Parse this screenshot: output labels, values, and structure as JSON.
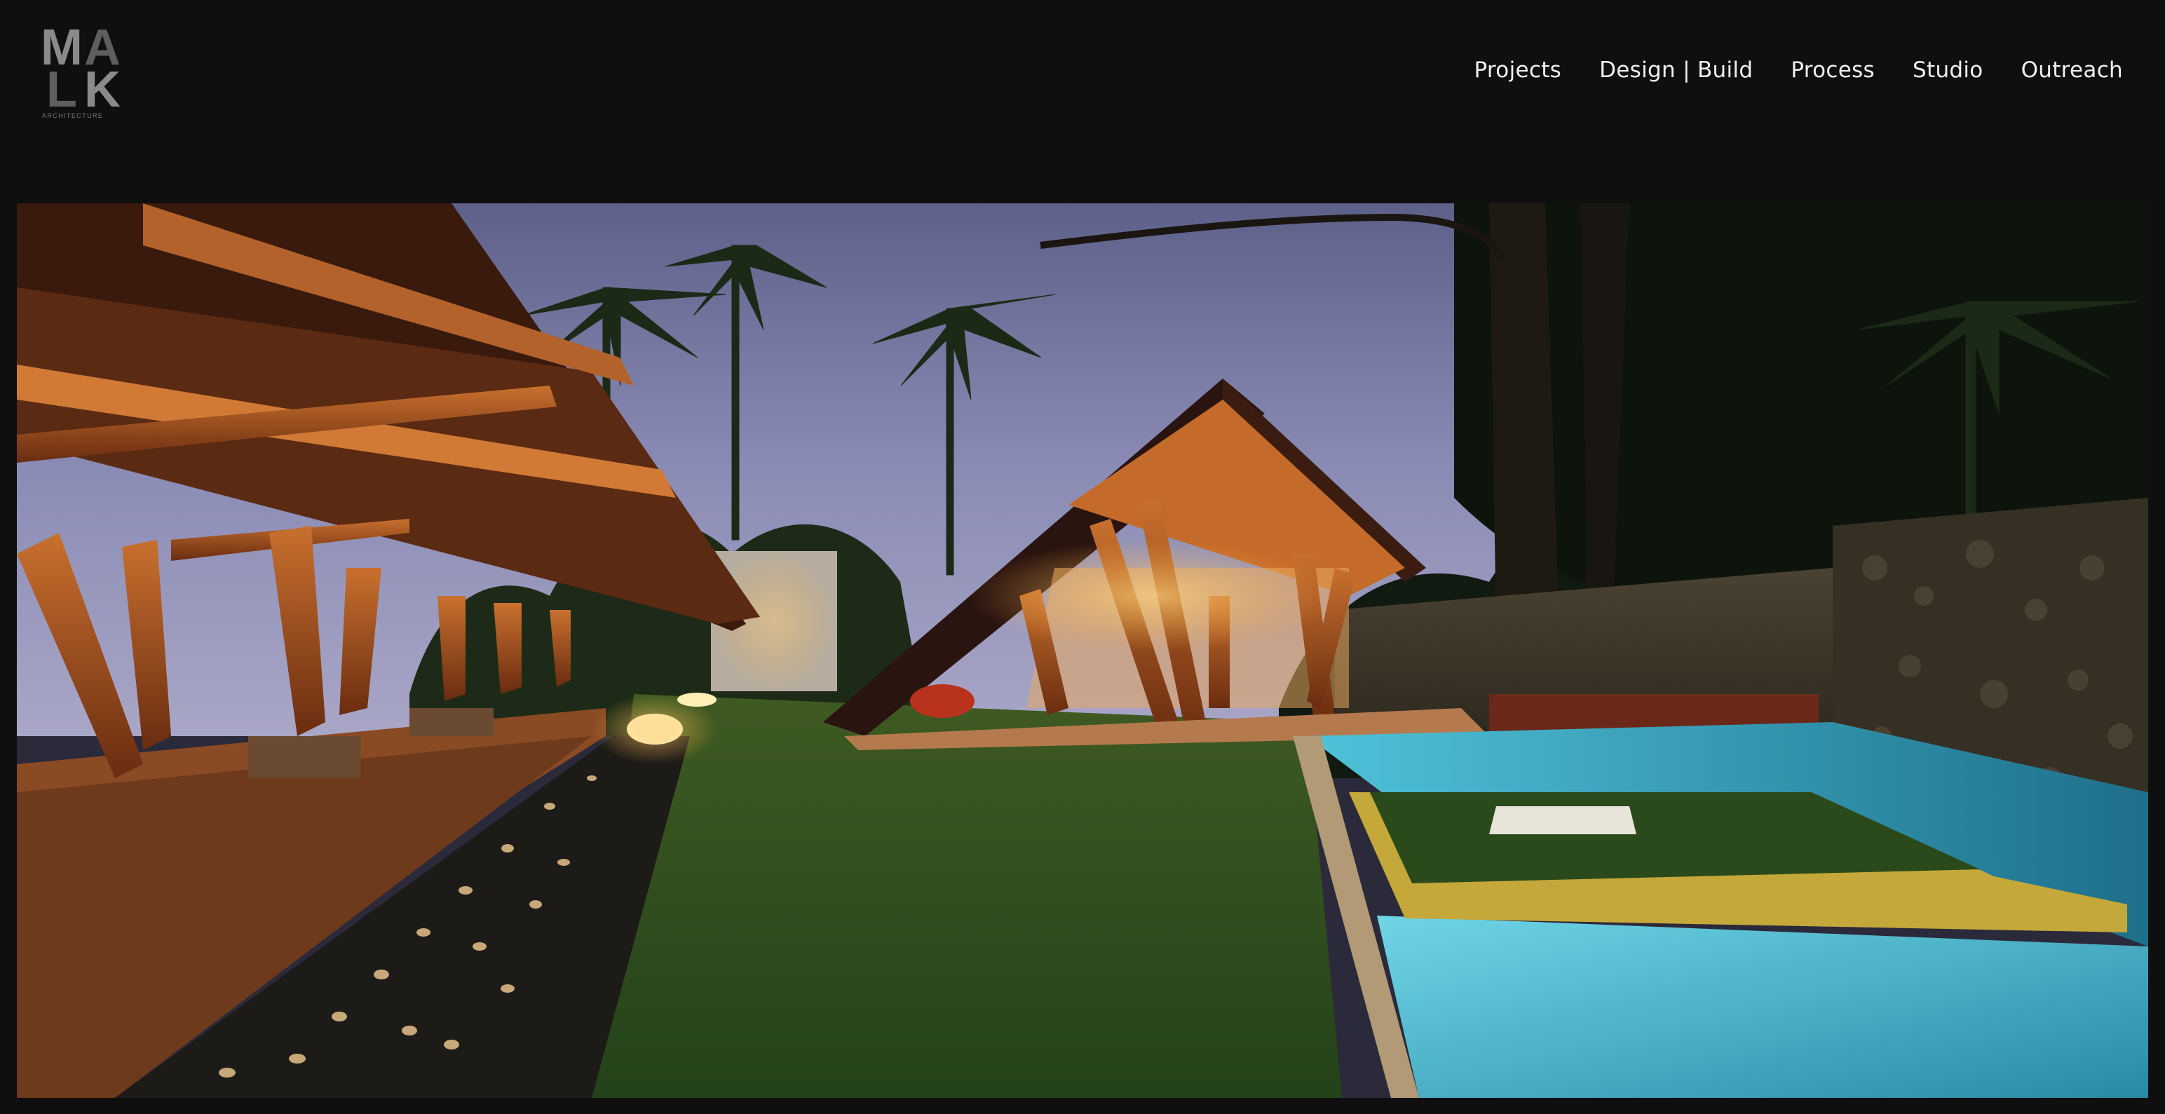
{
  "header": {
    "logo": {
      "letters": [
        "M",
        "A",
        "L",
        "K"
      ],
      "subtitle": "ARCHITECTURE"
    },
    "nav": [
      {
        "label": "Projects"
      },
      {
        "label": "Design | Build"
      },
      {
        "label": "Process"
      },
      {
        "label": "Studio"
      },
      {
        "label": "Outreach"
      }
    ]
  },
  "colors": {
    "background": "#0f0f0f",
    "nav_text": "#f0f0f0",
    "logo_light": "#8a8a8a",
    "logo_dark": "#5e5e5e"
  }
}
